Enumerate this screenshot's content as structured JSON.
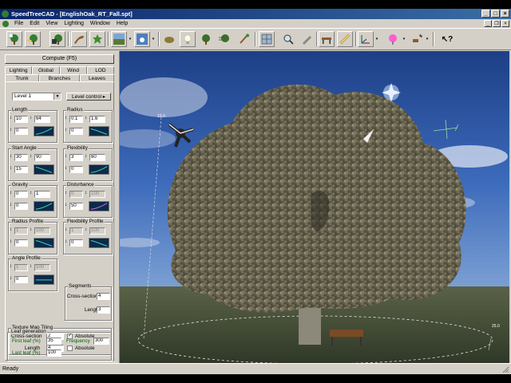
{
  "window": {
    "title": "SpeedTreeCAD - [EnglishOak_RT_Fall.spt]",
    "controls": [
      "_",
      "□",
      "×"
    ]
  },
  "menu": [
    "File",
    "Edit",
    "View",
    "Lighting",
    "Window",
    "Help"
  ],
  "mdi_controls": [
    "_",
    "❐",
    "×"
  ],
  "toolbar": {
    "icons": [
      "new-tree-icon",
      "open-tree-icon",
      "save-tree-icon",
      "bark-texture-icon",
      "leaf-texture-icon",
      "ground-texture-icon",
      "sky-texture-icon",
      "seed-icon",
      "light-bulb-icon",
      "tree-small-icon",
      "tree-wind-icon",
      "paint-brush-icon",
      "frame-grid-icon",
      "zoom-icon",
      "pencil-icon",
      "bench-icon",
      "ruler-icon",
      "axes-icon",
      "pink-ball-icon",
      "wind-fan-icon",
      "help-icon"
    ]
  },
  "panel": {
    "compute_label": "Compute (F5)",
    "tabs_row1": [
      "Lighting",
      "Global",
      "Wind",
      "LOD"
    ],
    "tabs_row2": [
      "Trunk",
      "Branches",
      "Leaves"
    ],
    "active_tab": "Branches",
    "level_select": "Level 1",
    "level_control_label": "Level control",
    "groups": {
      "length": {
        "label": "Length",
        "v1": "10",
        "v2": "64",
        "v3": "0"
      },
      "radius": {
        "label": "Radius",
        "v1": "0.1",
        "v2": "1.6",
        "v3": "0"
      },
      "start_angle": {
        "label": "Start Angle",
        "v1": "30",
        "v2": "90",
        "v3": "15"
      },
      "flexibility": {
        "label": "Flexibility",
        "v1": "3",
        "v2": "60",
        "v3": "0"
      },
      "gravity": {
        "label": "Gravity",
        "v1": "0",
        "v2": "1",
        "v3": "0"
      },
      "disturbance": {
        "label": "Disturbance",
        "v1": "0",
        "v2": "100",
        "v3": "50"
      },
      "radius_profile": {
        "label": "Radius Profile",
        "v1": "1",
        "v2": "100",
        "v3": "0"
      },
      "flexibility_profile": {
        "label": "Flexibility Profile",
        "v1": "1",
        "v2": "100",
        "v3": "0"
      },
      "angle_profile": {
        "label": "Angle Profile",
        "v1": "1",
        "v2": "100",
        "v3": "0"
      }
    },
    "segments": {
      "label": "Segments",
      "cross_label": "Cross-section",
      "cross_value": "4",
      "length_label": "Length",
      "length_value": "3"
    },
    "texture_tiling": {
      "label": "Texture Map Tiling",
      "cross_label": "Cross-section",
      "cross_value": "2",
      "length_label": "Length",
      "length_value": "4",
      "absolute_label": "Absolute",
      "absolute1_checked": "✓",
      "absolute2_checked": ""
    },
    "leaf_gen": {
      "label": "Leaf generation",
      "first_label": "First leaf (%)",
      "first_value": "35",
      "frequency_label": "Frequency",
      "frequency_value": "300",
      "last_label": "Last leaf (%)",
      "last_value": "100"
    }
  },
  "viewport": {
    "sky_color": "#3a67b6",
    "ground_color": "#3f4a35",
    "height_label": "10.0",
    "radius_label": "25.0"
  },
  "status": "Ready"
}
